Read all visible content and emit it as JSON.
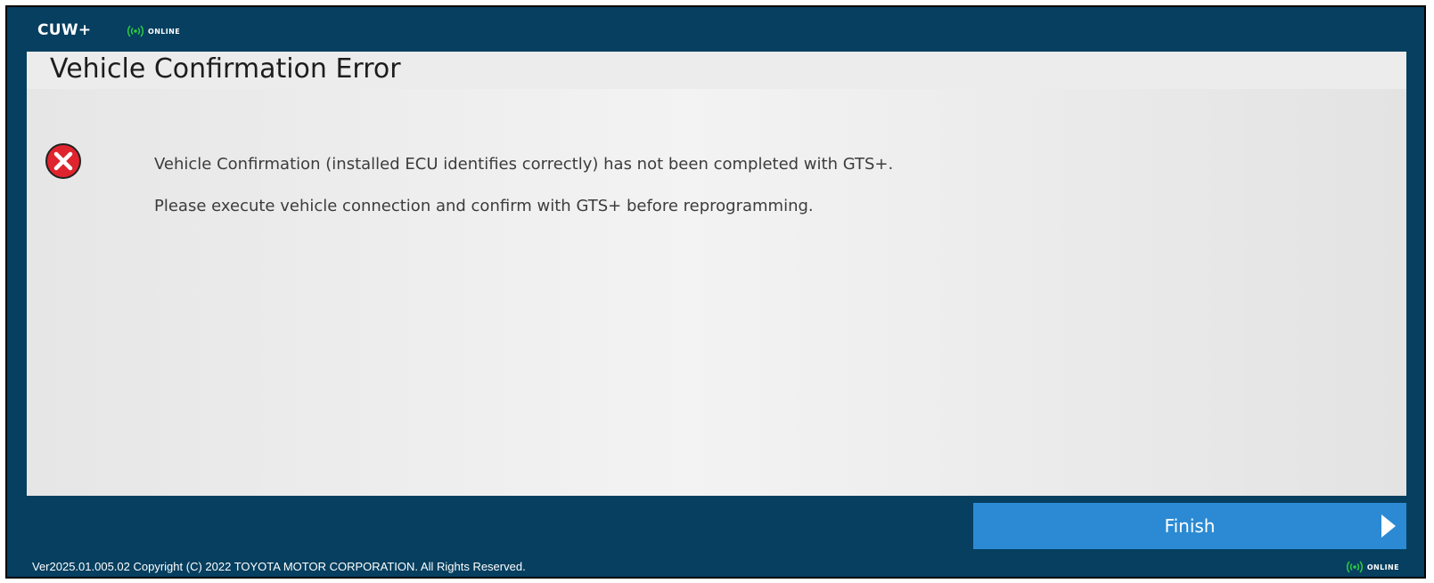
{
  "app": {
    "logo": "CUW+",
    "status": "ONLINE"
  },
  "page": {
    "title": "Vehicle Confirmation Error"
  },
  "messages": {
    "line1": "Vehicle Confirmation (installed ECU identifies correctly) has not been completed with GTS+.",
    "line2": "Please execute vehicle connection and confirm with GTS+ before reprogramming."
  },
  "actions": {
    "finish_label": "Finish"
  },
  "footer": {
    "version_copyright": "Ver2025.01.005.02  Copyright (C) 2022 TOYOTA MOTOR CORPORATION. All Rights Reserved.",
    "status": "ONLINE"
  },
  "icons": {
    "status": "signal-icon",
    "error": "error-x-icon",
    "finish": "arrow-right-icon"
  },
  "colors": {
    "header_bg": "#063f5f",
    "status_green": "#2ecc40",
    "error_red": "#e0242e",
    "button_blue": "#2b8ad3"
  }
}
